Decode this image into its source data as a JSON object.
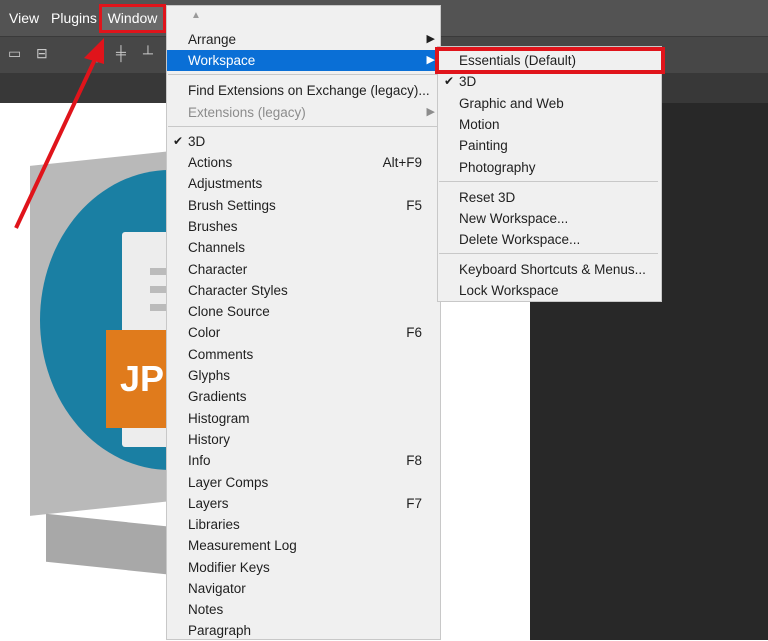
{
  "menubar": {
    "items": [
      "View",
      "Plugins"
    ],
    "window_label": "Window"
  },
  "canvas": {
    "badge_text": "JP"
  },
  "window_menu": {
    "items": [
      {
        "label": "Arrange",
        "submenu": true
      },
      {
        "label": "Workspace",
        "submenu": true,
        "selected": true
      },
      {
        "label": "Find Extensions on Exchange (legacy)..."
      },
      {
        "label": "Extensions (legacy)",
        "submenu": true,
        "disabled": true
      },
      {
        "label": "3D",
        "checked": true
      },
      {
        "label": "Actions",
        "shortcut": "Alt+F9"
      },
      {
        "label": "Adjustments"
      },
      {
        "label": "Brush Settings",
        "shortcut": "F5"
      },
      {
        "label": "Brushes"
      },
      {
        "label": "Channels"
      },
      {
        "label": "Character"
      },
      {
        "label": "Character Styles"
      },
      {
        "label": "Clone Source"
      },
      {
        "label": "Color",
        "shortcut": "F6"
      },
      {
        "label": "Comments"
      },
      {
        "label": "Glyphs"
      },
      {
        "label": "Gradients"
      },
      {
        "label": "Histogram"
      },
      {
        "label": "History"
      },
      {
        "label": "Info",
        "shortcut": "F8"
      },
      {
        "label": "Layer Comps"
      },
      {
        "label": "Layers",
        "shortcut": "F7"
      },
      {
        "label": "Libraries"
      },
      {
        "label": "Measurement Log"
      },
      {
        "label": "Modifier Keys"
      },
      {
        "label": "Navigator"
      },
      {
        "label": "Notes"
      },
      {
        "label": "Paragraph"
      }
    ]
  },
  "workspace_submenu": {
    "items": [
      {
        "label": "Essentials (Default)"
      },
      {
        "label": "3D",
        "checked": true
      },
      {
        "label": "Graphic and Web"
      },
      {
        "label": "Motion"
      },
      {
        "label": "Painting"
      },
      {
        "label": "Photography"
      },
      {
        "label": "Reset 3D"
      },
      {
        "label": "New Workspace..."
      },
      {
        "label": "Delete Workspace..."
      },
      {
        "label": "Keyboard Shortcuts & Menus..."
      },
      {
        "label": "Lock Workspace"
      }
    ]
  },
  "colors": {
    "highlight": "#0a6fd6",
    "annotation": "#e0141b",
    "menu_bg": "#f0f0f0"
  }
}
